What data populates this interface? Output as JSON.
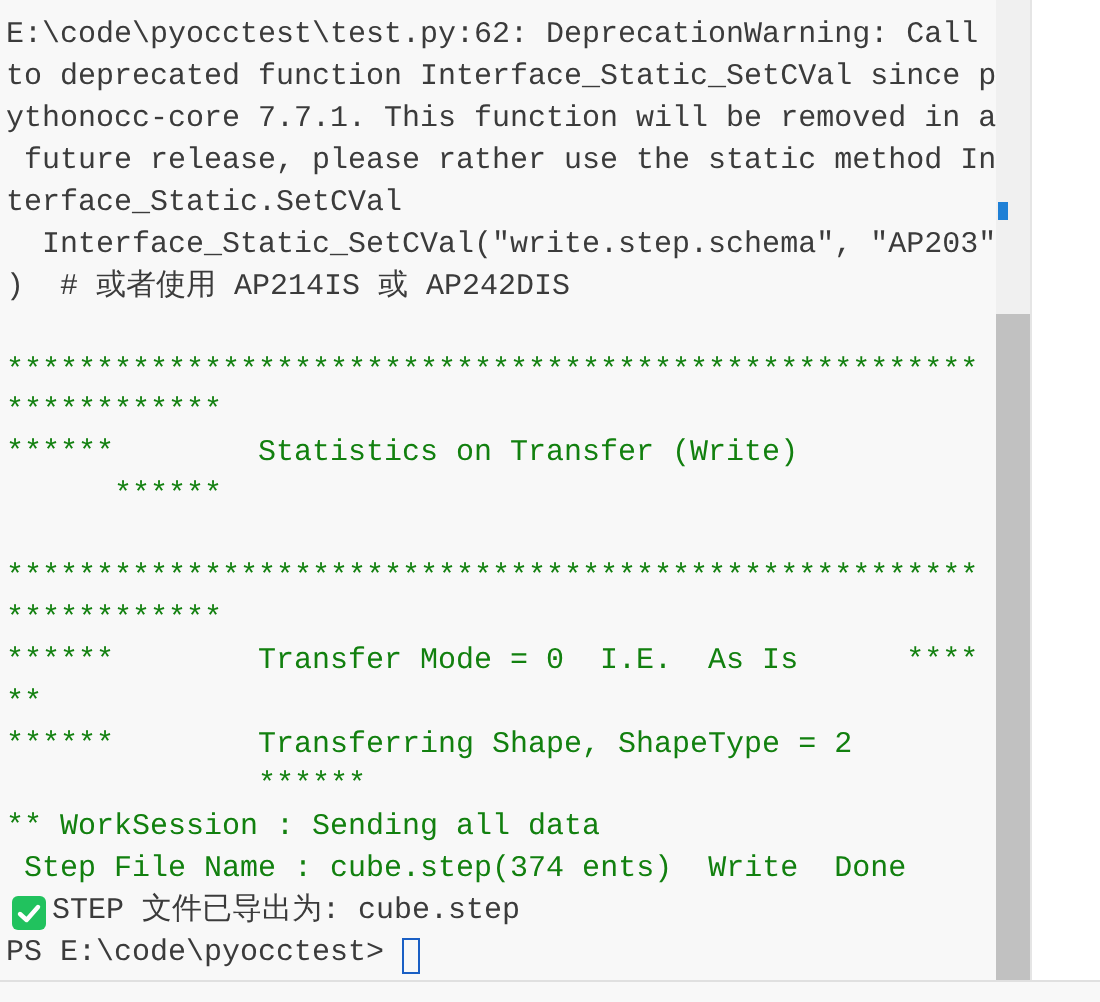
{
  "terminal": {
    "lines": [
      {
        "kind": "plain",
        "text": "E:\\code\\pyocctest\\test.py:62: DeprecationWarning: Call"
      },
      {
        "kind": "plain",
        "text": "to deprecated function Interface_Static_SetCVal since p"
      },
      {
        "kind": "plain",
        "text": "ythonocc-core 7.7.1. This function will be removed in a"
      },
      {
        "kind": "plain",
        "text": " future release, please rather use the static method In"
      },
      {
        "kind": "plain",
        "text": "terface_Static.SetCVal"
      },
      {
        "kind": "plain",
        "text": "  Interface_Static_SetCVal(\"write.step.schema\", \"AP203\""
      },
      {
        "kind": "plain",
        "text": ")  # 或者使用 AP214IS 或 AP242DIS"
      },
      {
        "kind": "blank"
      },
      {
        "kind": "occ",
        "text": "******************************************************************"
      },
      {
        "kind": "occ",
        "text": "******        Statistics on Transfer (Write)                ******"
      },
      {
        "kind": "blank"
      },
      {
        "kind": "occ",
        "text": "******************************************************************"
      },
      {
        "kind": "occ",
        "text": "******        Transfer Mode = 0  I.E.  As Is      ****"
      },
      {
        "kind": "occ",
        "text": "**"
      },
      {
        "kind": "occ",
        "text": "******        Transferring Shape, ShapeType = 2                     ******"
      },
      {
        "kind": "occ",
        "text": "** WorkSession : Sending all data"
      },
      {
        "kind": "occ",
        "text": " Step File Name : cube.step(374 ents)  Write  Done"
      },
      {
        "kind": "success",
        "text": "STEP 文件已导出为: cube.step"
      },
      {
        "kind": "prompt",
        "text": "PS E:\\code\\pyocctest>"
      }
    ]
  }
}
